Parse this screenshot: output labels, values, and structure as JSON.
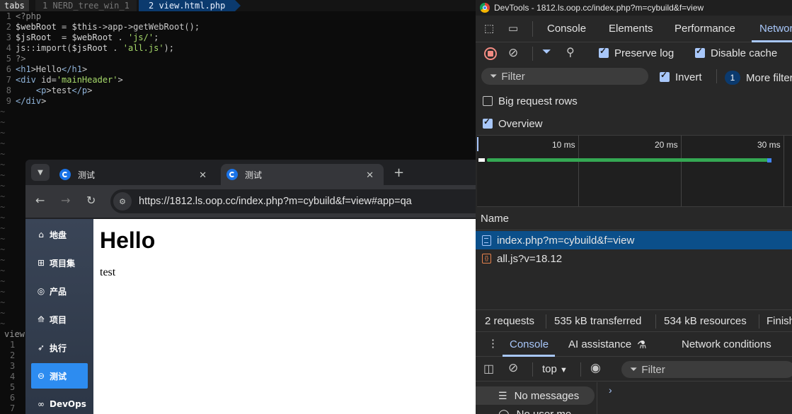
{
  "vim": {
    "tabline_label": "tabs",
    "tab1": "1 NERD_tree_win_1",
    "tab2": "2 view.html.php",
    "lines": [
      {
        "n": "1",
        "html": "<?php"
      },
      {
        "n": "2",
        "html": "$webRoot = $this->app->getWebRoot();"
      },
      {
        "n": "3",
        "html": "$jsRoot  = $webRoot . 'js/';"
      },
      {
        "n": "4",
        "html": "js::import($jsRoot . 'all.js');"
      },
      {
        "n": "5",
        "html": "?>"
      },
      {
        "n": "6",
        "html": "<h1>Hello</h1>"
      },
      {
        "n": "7",
        "html": "<div id='mainHeader'>"
      },
      {
        "n": "8",
        "html": "    <p>test</p>"
      },
      {
        "n": "9",
        "html": "</div>"
      }
    ],
    "lower_label": "view",
    "lower_nums": [
      "1",
      "2",
      "3",
      "4",
      "5",
      "6",
      "7"
    ]
  },
  "browser": {
    "tab_inactive_title": "测试",
    "tab_active_title": "测试",
    "url": "https://1812.ls.oop.cc/index.php?m=cybuild&f=view#app=qa",
    "page": {
      "heading": "Hello",
      "paragraph": "test"
    },
    "sidebar": [
      {
        "icon": "⌂",
        "label": "地盘",
        "active": false,
        "name": "sidebar-item-dashboard"
      },
      {
        "icon": "⊞",
        "label": "项目集",
        "active": false,
        "name": "sidebar-item-program"
      },
      {
        "icon": "◎",
        "label": "产品",
        "active": false,
        "name": "sidebar-item-product"
      },
      {
        "icon": "⟰",
        "label": "项目",
        "active": false,
        "name": "sidebar-item-project"
      },
      {
        "icon": "➶",
        "label": "执行",
        "active": false,
        "name": "sidebar-item-execution"
      },
      {
        "icon": "⊖",
        "label": "测试",
        "active": true,
        "name": "sidebar-item-test"
      },
      {
        "icon": "∞",
        "label": "DevOps",
        "active": false,
        "name": "sidebar-item-devops"
      }
    ]
  },
  "devtools": {
    "window_title": "DevTools - 1812.ls.oop.cc/index.php?m=cybuild&f=view",
    "tabs": [
      "Console",
      "Elements",
      "Performance",
      "Network"
    ],
    "preserve_log": "Preserve log",
    "disable_cache": "Disable cache",
    "filter_placeholder": "Filter",
    "invert": "Invert",
    "more_filters_count": "1",
    "more_filters": "More filters",
    "big_request_rows": "Big request rows",
    "overview": "Overview",
    "ticks": [
      "10 ms",
      "20 ms",
      "30 ms"
    ],
    "name_column": "Name",
    "requests": [
      {
        "name": "index.php?m=cybuild&f=view",
        "type": "document",
        "selected": true
      },
      {
        "name": "all.js?v=18.12",
        "type": "script",
        "selected": false
      }
    ],
    "summary": {
      "requests": "2 requests",
      "transferred": "535 kB transferred",
      "resources": "534 kB resources",
      "finish": "Finish"
    },
    "drawer_tabs": [
      "Console",
      "AI assistance",
      "Network conditions"
    ],
    "console_context": "top",
    "console_filter_placeholder": "Filter",
    "console_side": [
      "No messages",
      "No user me"
    ]
  }
}
